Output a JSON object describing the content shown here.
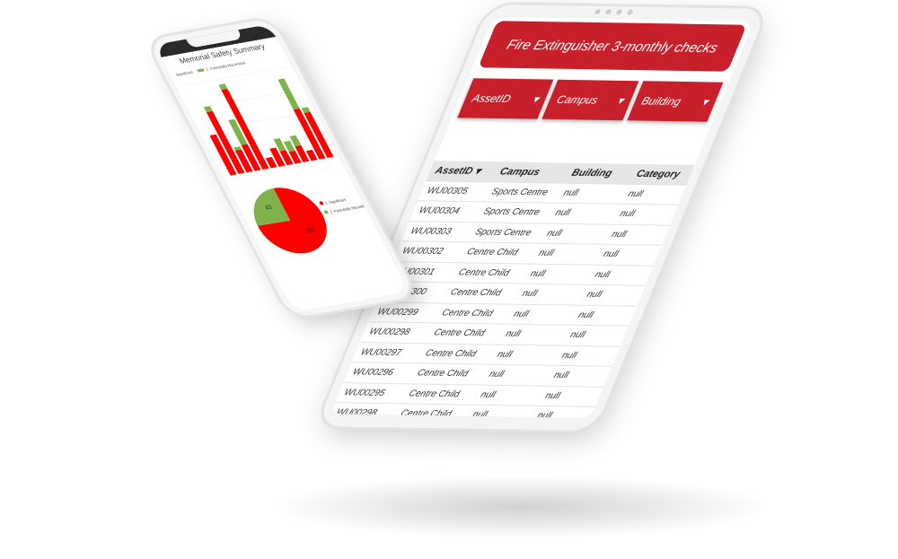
{
  "tablet": {
    "title": "Fire Extinguisher 3-monthly checks",
    "filters": [
      {
        "label": "AssetID"
      },
      {
        "label": "Campus"
      },
      {
        "label": "Building"
      }
    ],
    "columns": [
      "AssetID",
      "Campus",
      "Building",
      "Category"
    ],
    "sort_icon": "caret-down-icon",
    "rows": [
      [
        "WU00305",
        "Sports Centre",
        "null",
        "null"
      ],
      [
        "WU00304",
        "Sports Centre",
        "null",
        "null"
      ],
      [
        "WU00303",
        "Sports Centre",
        "null",
        "null"
      ],
      [
        "WU00302",
        "Centre Child",
        "null",
        "null"
      ],
      [
        "WU00301",
        "Centre Child",
        "null",
        "null"
      ],
      [
        "WU00300",
        "Centre Child",
        "null",
        "null"
      ],
      [
        "WU00299",
        "Centre Child",
        "null",
        "null"
      ],
      [
        "WU00298",
        "Centre Child",
        "null",
        "null"
      ],
      [
        "WU00297",
        "Centre Child",
        "null",
        "null"
      ],
      [
        "WU00296",
        "Centre Child",
        "null",
        "null"
      ],
      [
        "WU00295",
        "Centre Child",
        "null",
        "null"
      ],
      [
        "WU00298",
        "Centre Child",
        "null",
        "null"
      ],
      [
        "WU00297",
        "Centre Child",
        "null",
        "null"
      ]
    ],
    "accent": "#c8202a"
  },
  "phone": {
    "title": "Memorial Safety Summary",
    "colors": {
      "significant": "#ff0000",
      "hazardous": "#7fb24a"
    }
  },
  "chart_data": [
    {
      "type": "bar",
      "stacked": true,
      "legend": [
        "Significant",
        "2. Potentially Hazardous"
      ],
      "series": [
        {
          "name": "Significant",
          "values": [
            40,
            62,
            22,
            26,
            80,
            10,
            18,
            14,
            12,
            16,
            10,
            50,
            45
          ]
        },
        {
          "name": "2. Potentially Hazardous",
          "values": [
            0,
            5,
            3,
            25,
            5,
            0,
            0,
            12,
            10,
            10,
            0,
            30,
            5
          ]
        }
      ],
      "grid": true
    },
    {
      "type": "pie",
      "labels": [
        "1. Significant",
        "2. Potentially Hazardous"
      ],
      "values": [
        131,
        43
      ],
      "legend_placement": "right"
    }
  ]
}
